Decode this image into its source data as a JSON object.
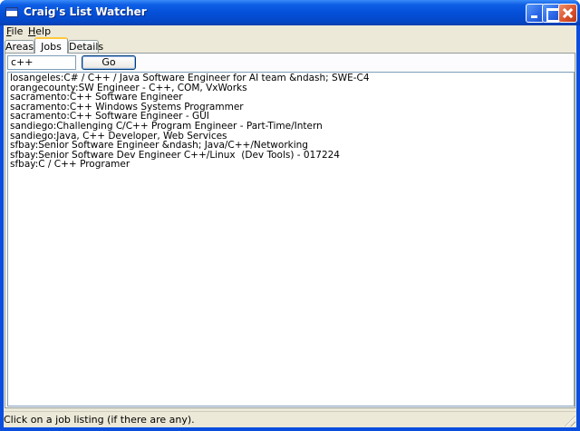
{
  "window": {
    "title": "Craig's List Watcher"
  },
  "menu": {
    "file": {
      "accel": "F",
      "rest": "ile"
    },
    "help": {
      "accel": "H",
      "rest": "elp"
    }
  },
  "tabs": [
    {
      "label": "Areas"
    },
    {
      "label": "Jobs"
    },
    {
      "label": "Details"
    }
  ],
  "search": {
    "value": "c++",
    "go_label": "Go"
  },
  "jobs": [
    "losangeles:C# / C++ / Java Software Engineer for AI team &ndash; SWE-C4",
    "orangecounty:SW Engineer - C++, COM, VxWorks",
    "sacramento:C++ Software Engineer",
    "sacramento:C++ Windows Systems Programmer",
    "sacramento:C++ Software Engineer - GUI",
    "sandiego:Challenging C/C++ Program Engineer - Part-Time/Intern",
    "sandiego:Java, C++ Developer, Web Services",
    "sfbay:Senior Software Engineer &ndash; Java/C++/Networking",
    "sfbay:Senior Software Dev Engineer C++/Linux  (Dev Tools) - 017224",
    "sfbay:C / C++ Programer"
  ],
  "status": {
    "text": "Click on a job listing (if there are any)."
  },
  "icons": [
    "app-icon",
    "minimize-icon",
    "maximize-icon",
    "close-icon",
    "size-grip-icon"
  ]
}
